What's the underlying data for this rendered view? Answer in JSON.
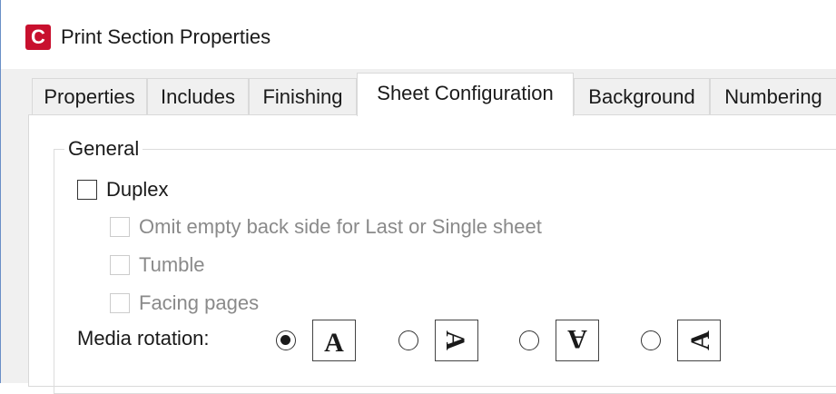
{
  "window": {
    "app_icon_letter": "C",
    "title": "Print Section Properties"
  },
  "tabs": [
    {
      "label": "Properties",
      "active": false
    },
    {
      "label": "Includes",
      "active": false
    },
    {
      "label": "Finishing",
      "active": false
    },
    {
      "label": "Sheet Configuration",
      "active": true
    },
    {
      "label": "Background",
      "active": false
    },
    {
      "label": "Numbering",
      "active": false
    }
  ],
  "general": {
    "legend": "General",
    "duplex": {
      "label": "Duplex",
      "checked": false,
      "enabled": true
    },
    "omit_empty_back": {
      "label": "Omit empty back side for Last or Single sheet",
      "checked": false,
      "enabled": false
    },
    "tumble": {
      "label": "Tumble",
      "checked": false,
      "enabled": false
    },
    "facing_pages": {
      "label": "Facing pages",
      "checked": false,
      "enabled": false
    },
    "media_rotation": {
      "label": "Media rotation:",
      "selected_index": 0,
      "options": [
        {
          "glyph": "A",
          "icon": "letter-a-upright-icon"
        },
        {
          "glyph": "A",
          "icon": "letter-a-rotated-right-icon"
        },
        {
          "glyph": "A",
          "icon": "letter-a-upside-down-icon"
        },
        {
          "glyph": "A",
          "icon": "letter-a-rotated-left-icon"
        }
      ]
    }
  }
}
